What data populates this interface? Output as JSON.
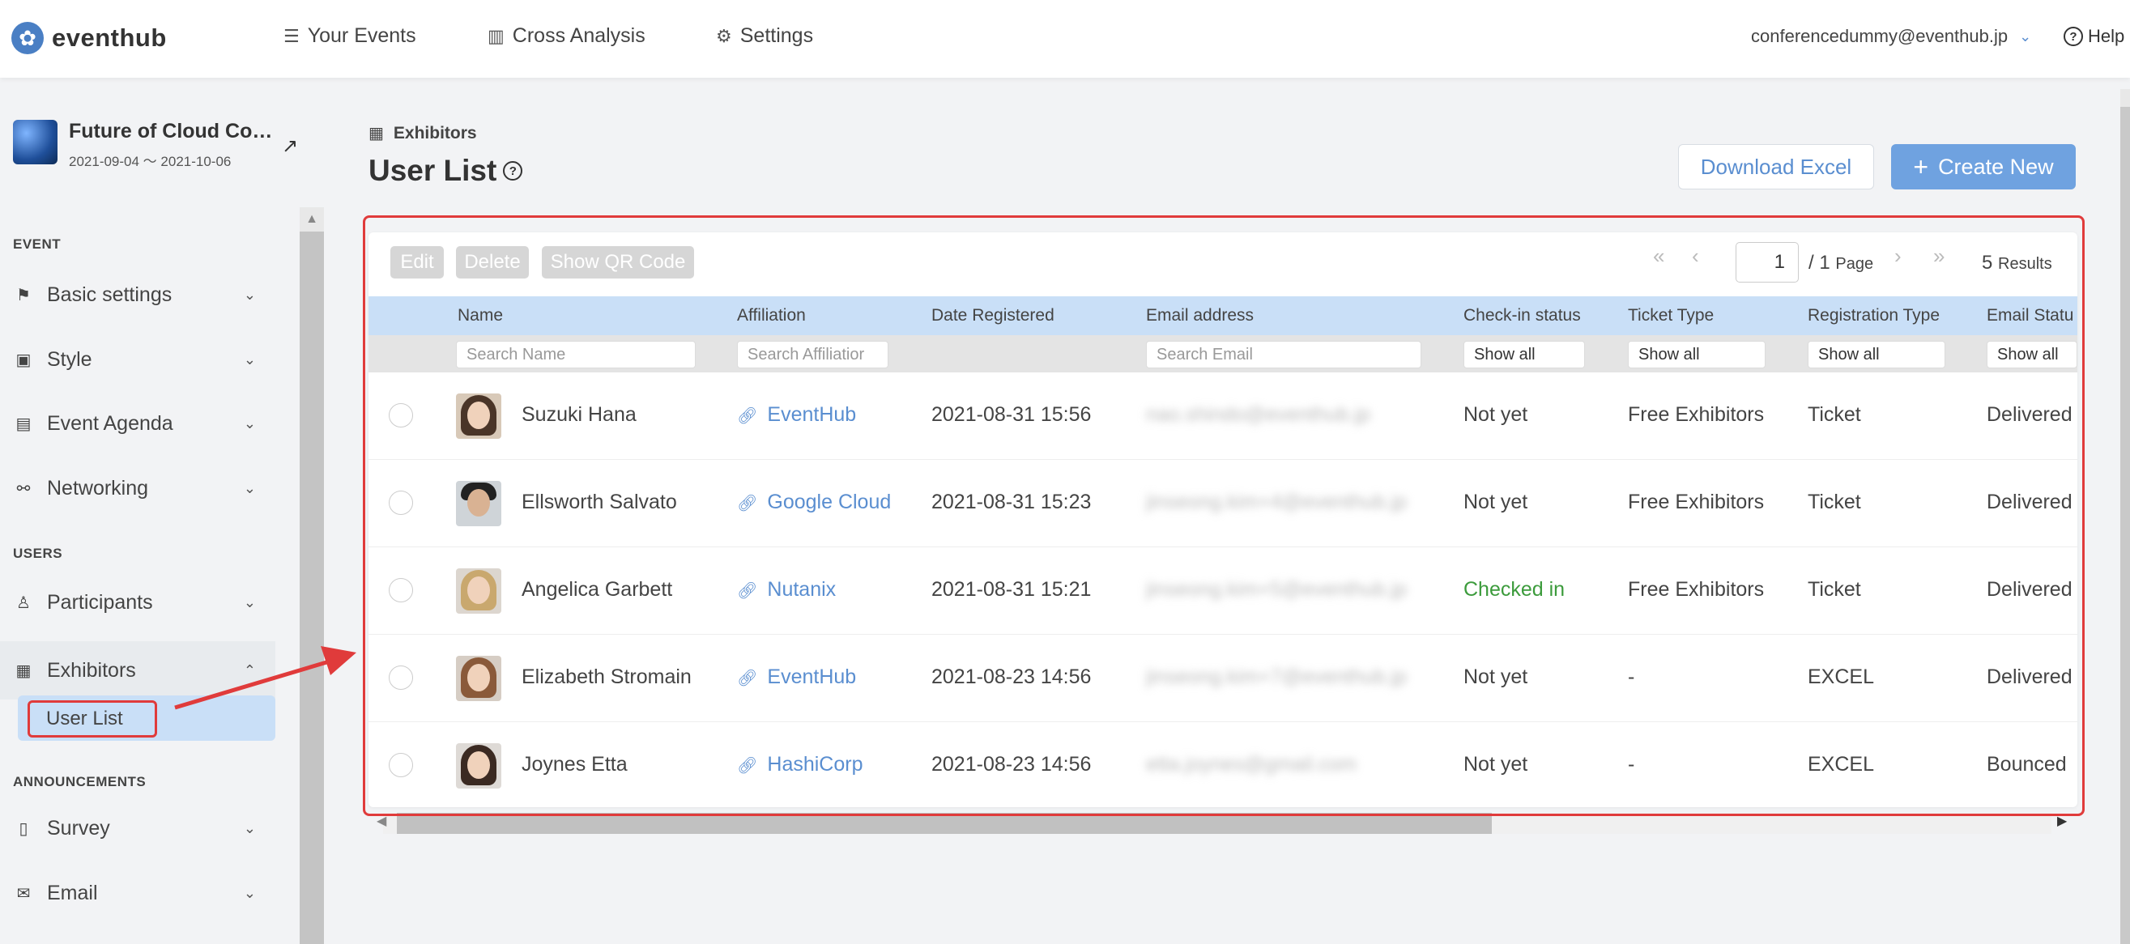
{
  "brand": {
    "name": "eventhub",
    "logo_icon": "flower-icon"
  },
  "nav": [
    {
      "label": "Your Events",
      "icon": "list-icon"
    },
    {
      "label": "Cross Analysis",
      "icon": "bar-chart-icon"
    },
    {
      "label": "Settings",
      "icon": "gear-icon"
    }
  ],
  "account": {
    "email": "conferencedummy@eventhub.jp"
  },
  "help": {
    "label": "Help"
  },
  "event": {
    "name": "Future of Cloud Co…",
    "dates": "2021-09-04 ～ 2021-10-06"
  },
  "sidebar": {
    "sections": [
      {
        "label": "EVENT"
      },
      {
        "label": "USERS"
      },
      {
        "label": "ANNOUNCEMENTS"
      }
    ],
    "items": [
      {
        "label": "Basic settings",
        "icon": "flag-icon"
      },
      {
        "label": "Style",
        "icon": "image-icon"
      },
      {
        "label": "Event Agenda",
        "icon": "list-icon"
      },
      {
        "label": "Networking",
        "icon": "binoculars-icon"
      },
      {
        "label": "Participants",
        "icon": "person-icon"
      },
      {
        "label": "Exhibitors",
        "icon": "building-icon"
      },
      {
        "label": "Survey",
        "icon": "clipboard-icon"
      },
      {
        "label": "Email",
        "icon": "envelope-icon"
      }
    ],
    "sub_active": "User List"
  },
  "breadcrumb": "Exhibitors",
  "page_title": "User List",
  "actions": {
    "download": "Download Excel",
    "create": "Create New"
  },
  "toolbar": {
    "edit": "Edit",
    "delete": "Delete",
    "qr": "Show QR Code"
  },
  "pager": {
    "page": "1",
    "total": "/ 1",
    "page_word": "Page",
    "results_count": "5",
    "results_word": "Results"
  },
  "columns": [
    "Name",
    "Affiliation",
    "Date Registered",
    "Email address",
    "Check-in status",
    "Ticket Type",
    "Registration Type",
    "Email Statu"
  ],
  "filters": {
    "name": "Search Name",
    "affiliation": "Search Affiliatior",
    "email": "Search Email",
    "checkin": "Show all",
    "ticket": "Show all",
    "registration": "Show all",
    "email_status": "Show all"
  },
  "rows": [
    {
      "name": "Suzuki Hana",
      "affiliation": "EventHub",
      "date": "2021-08-31 15:56",
      "email": "nao.shindo@eventhub.jp",
      "checkin": "Not yet",
      "ticket": "Free Exhibitors",
      "registration": "Ticket",
      "email_status": "Delivered"
    },
    {
      "name": "Ellsworth Salvato",
      "affiliation": "Google Cloud",
      "date": "2021-08-31 15:23",
      "email": "jinseong.kim+4@eventhub.jp",
      "checkin": "Not yet",
      "ticket": "Free Exhibitors",
      "registration": "Ticket",
      "email_status": "Delivered"
    },
    {
      "name": "Angelica Garbett",
      "affiliation": "Nutanix",
      "date": "2021-08-31 15:21",
      "email": "jinseong.kim+5@eventhub.jp",
      "checkin": "Checked in",
      "ticket": "Free Exhibitors",
      "registration": "Ticket",
      "email_status": "Delivered"
    },
    {
      "name": "Elizabeth Stromain",
      "affiliation": "EventHub",
      "date": "2021-08-23 14:56",
      "email": "jinseong.kim+7@eventhub.jp",
      "checkin": "Not yet",
      "ticket": "-",
      "registration": "EXCEL",
      "email_status": "Delivered"
    },
    {
      "name": "Joynes Etta",
      "affiliation": "HashiCorp",
      "date": "2021-08-23 14:56",
      "email": "etta.joynes@gmail.com",
      "checkin": "Not yet",
      "ticket": "-",
      "registration": "EXCEL",
      "email_status": "Bounced"
    }
  ],
  "colors": {
    "accent": "#5a8ed0",
    "highlight": "#e03b3b",
    "checked_in": "#3c9b3c",
    "header_bg": "#c9dff7"
  }
}
